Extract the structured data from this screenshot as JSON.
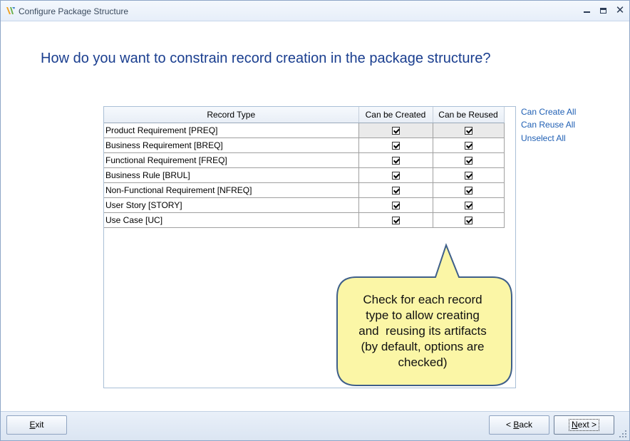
{
  "window": {
    "title": "Configure Package Structure",
    "min_glyph": "",
    "close_glyph": "✕"
  },
  "question": "How do you want to constrain record creation in the package structure?",
  "grid": {
    "columns": [
      "Record Type",
      "Can be Created",
      "Can be Reused"
    ],
    "rows": [
      {
        "type": "Product Requirement [PREQ]",
        "created": true,
        "reused": true
      },
      {
        "type": "Business Requirement [BREQ]",
        "created": true,
        "reused": true
      },
      {
        "type": "Functional Requirement [FREQ]",
        "created": true,
        "reused": true
      },
      {
        "type": "Business Rule [BRUL]",
        "created": true,
        "reused": true
      },
      {
        "type": "Non-Functional Requirement [NFREQ]",
        "created": true,
        "reused": true
      },
      {
        "type": "User Story [STORY]",
        "created": true,
        "reused": true
      },
      {
        "type": "Use Case [UC]",
        "created": true,
        "reused": true
      }
    ]
  },
  "links": {
    "can_create_all": "Can Create All",
    "can_reuse_all": "Can Reuse All",
    "unselect_all": "Unselect All"
  },
  "callout": {
    "line1": "Check for each record",
    "line2": "type to allow creating",
    "line3": "and  reusing its artifacts",
    "line4": "(by default, options are",
    "line5": "checked)"
  },
  "buttons": {
    "exit": "Exit",
    "back_prefix": "< ",
    "back": "Back",
    "next": "Next >"
  },
  "colors": {
    "heading": "#1a3e8f",
    "link": "#1f5fb4",
    "callout_fill": "#fbf6a6",
    "callout_stroke": "#3e5f8a"
  }
}
